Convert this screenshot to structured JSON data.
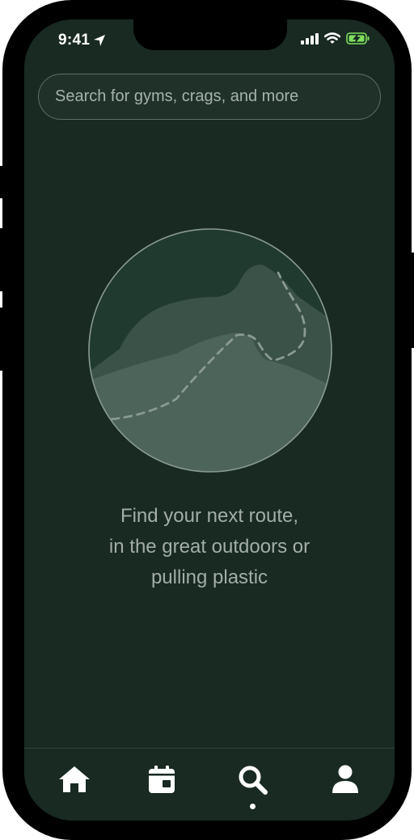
{
  "status_bar": {
    "time": "9:41",
    "icons": [
      "location-arrow-icon",
      "signal-icon",
      "wifi-icon",
      "battery-charging-icon"
    ]
  },
  "search": {
    "placeholder": "Search for gyms, crags, and more"
  },
  "empty_state": {
    "illustration": "mountain-route-illustration",
    "lines": [
      "Find your next route,",
      "in the great outdoors or",
      "pulling plastic"
    ]
  },
  "tab_bar": {
    "tabs": [
      {
        "icon": "home-icon",
        "active": false
      },
      {
        "icon": "calendar-icon",
        "active": false
      },
      {
        "icon": "search-icon",
        "active": true
      },
      {
        "icon": "profile-icon",
        "active": false
      }
    ]
  },
  "colors": {
    "background": "#182a22",
    "text_muted": "#a3aea8",
    "border": "#5d7067",
    "icon": "#ffffff",
    "battery": "#7ee05c"
  }
}
